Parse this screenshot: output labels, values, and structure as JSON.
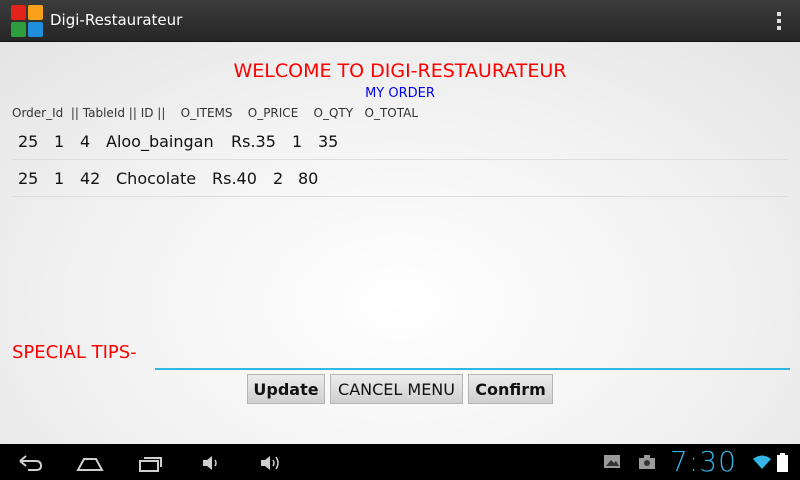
{
  "app": {
    "title": "Digi-Restaurateur",
    "brand_colors": [
      "#e2231a",
      "#f9a11b",
      "#2e9e3e",
      "#1f8fdc"
    ]
  },
  "page": {
    "welcome": "WELCOME TO DIGI-RESTAURATEUR",
    "subtitle": "MY ORDER",
    "header": "Order_Id  || TableId || ID ||    O_ITEMS    O_PRICE    O_QTY   O_TOTAL"
  },
  "orders": [
    {
      "order_id": "25",
      "table_id": "1",
      "id": "4",
      "item": "Aloo_baingan",
      "price": "Rs.35",
      "qty": "1",
      "total": "35"
    },
    {
      "order_id": "25",
      "table_id": "1",
      "id": "42",
      "item": "Chocolate",
      "price": "Rs.40",
      "qty": "2",
      "total": "80"
    }
  ],
  "tips": {
    "label": "SPECIAL TIPS-",
    "value": "",
    "placeholder": ""
  },
  "buttons": {
    "update": "Update",
    "cancel": "CANCEL MENU",
    "confirm": "Confirm"
  },
  "statusbar": {
    "time": "7:30",
    "accent": "#33b5e5"
  },
  "icons": [
    "back-icon",
    "home-icon",
    "recent-apps-icon",
    "volume-down-icon",
    "volume-up-icon",
    "gallery-icon",
    "camera-icon",
    "wifi-icon",
    "battery-icon",
    "overflow-menu-icon"
  ]
}
